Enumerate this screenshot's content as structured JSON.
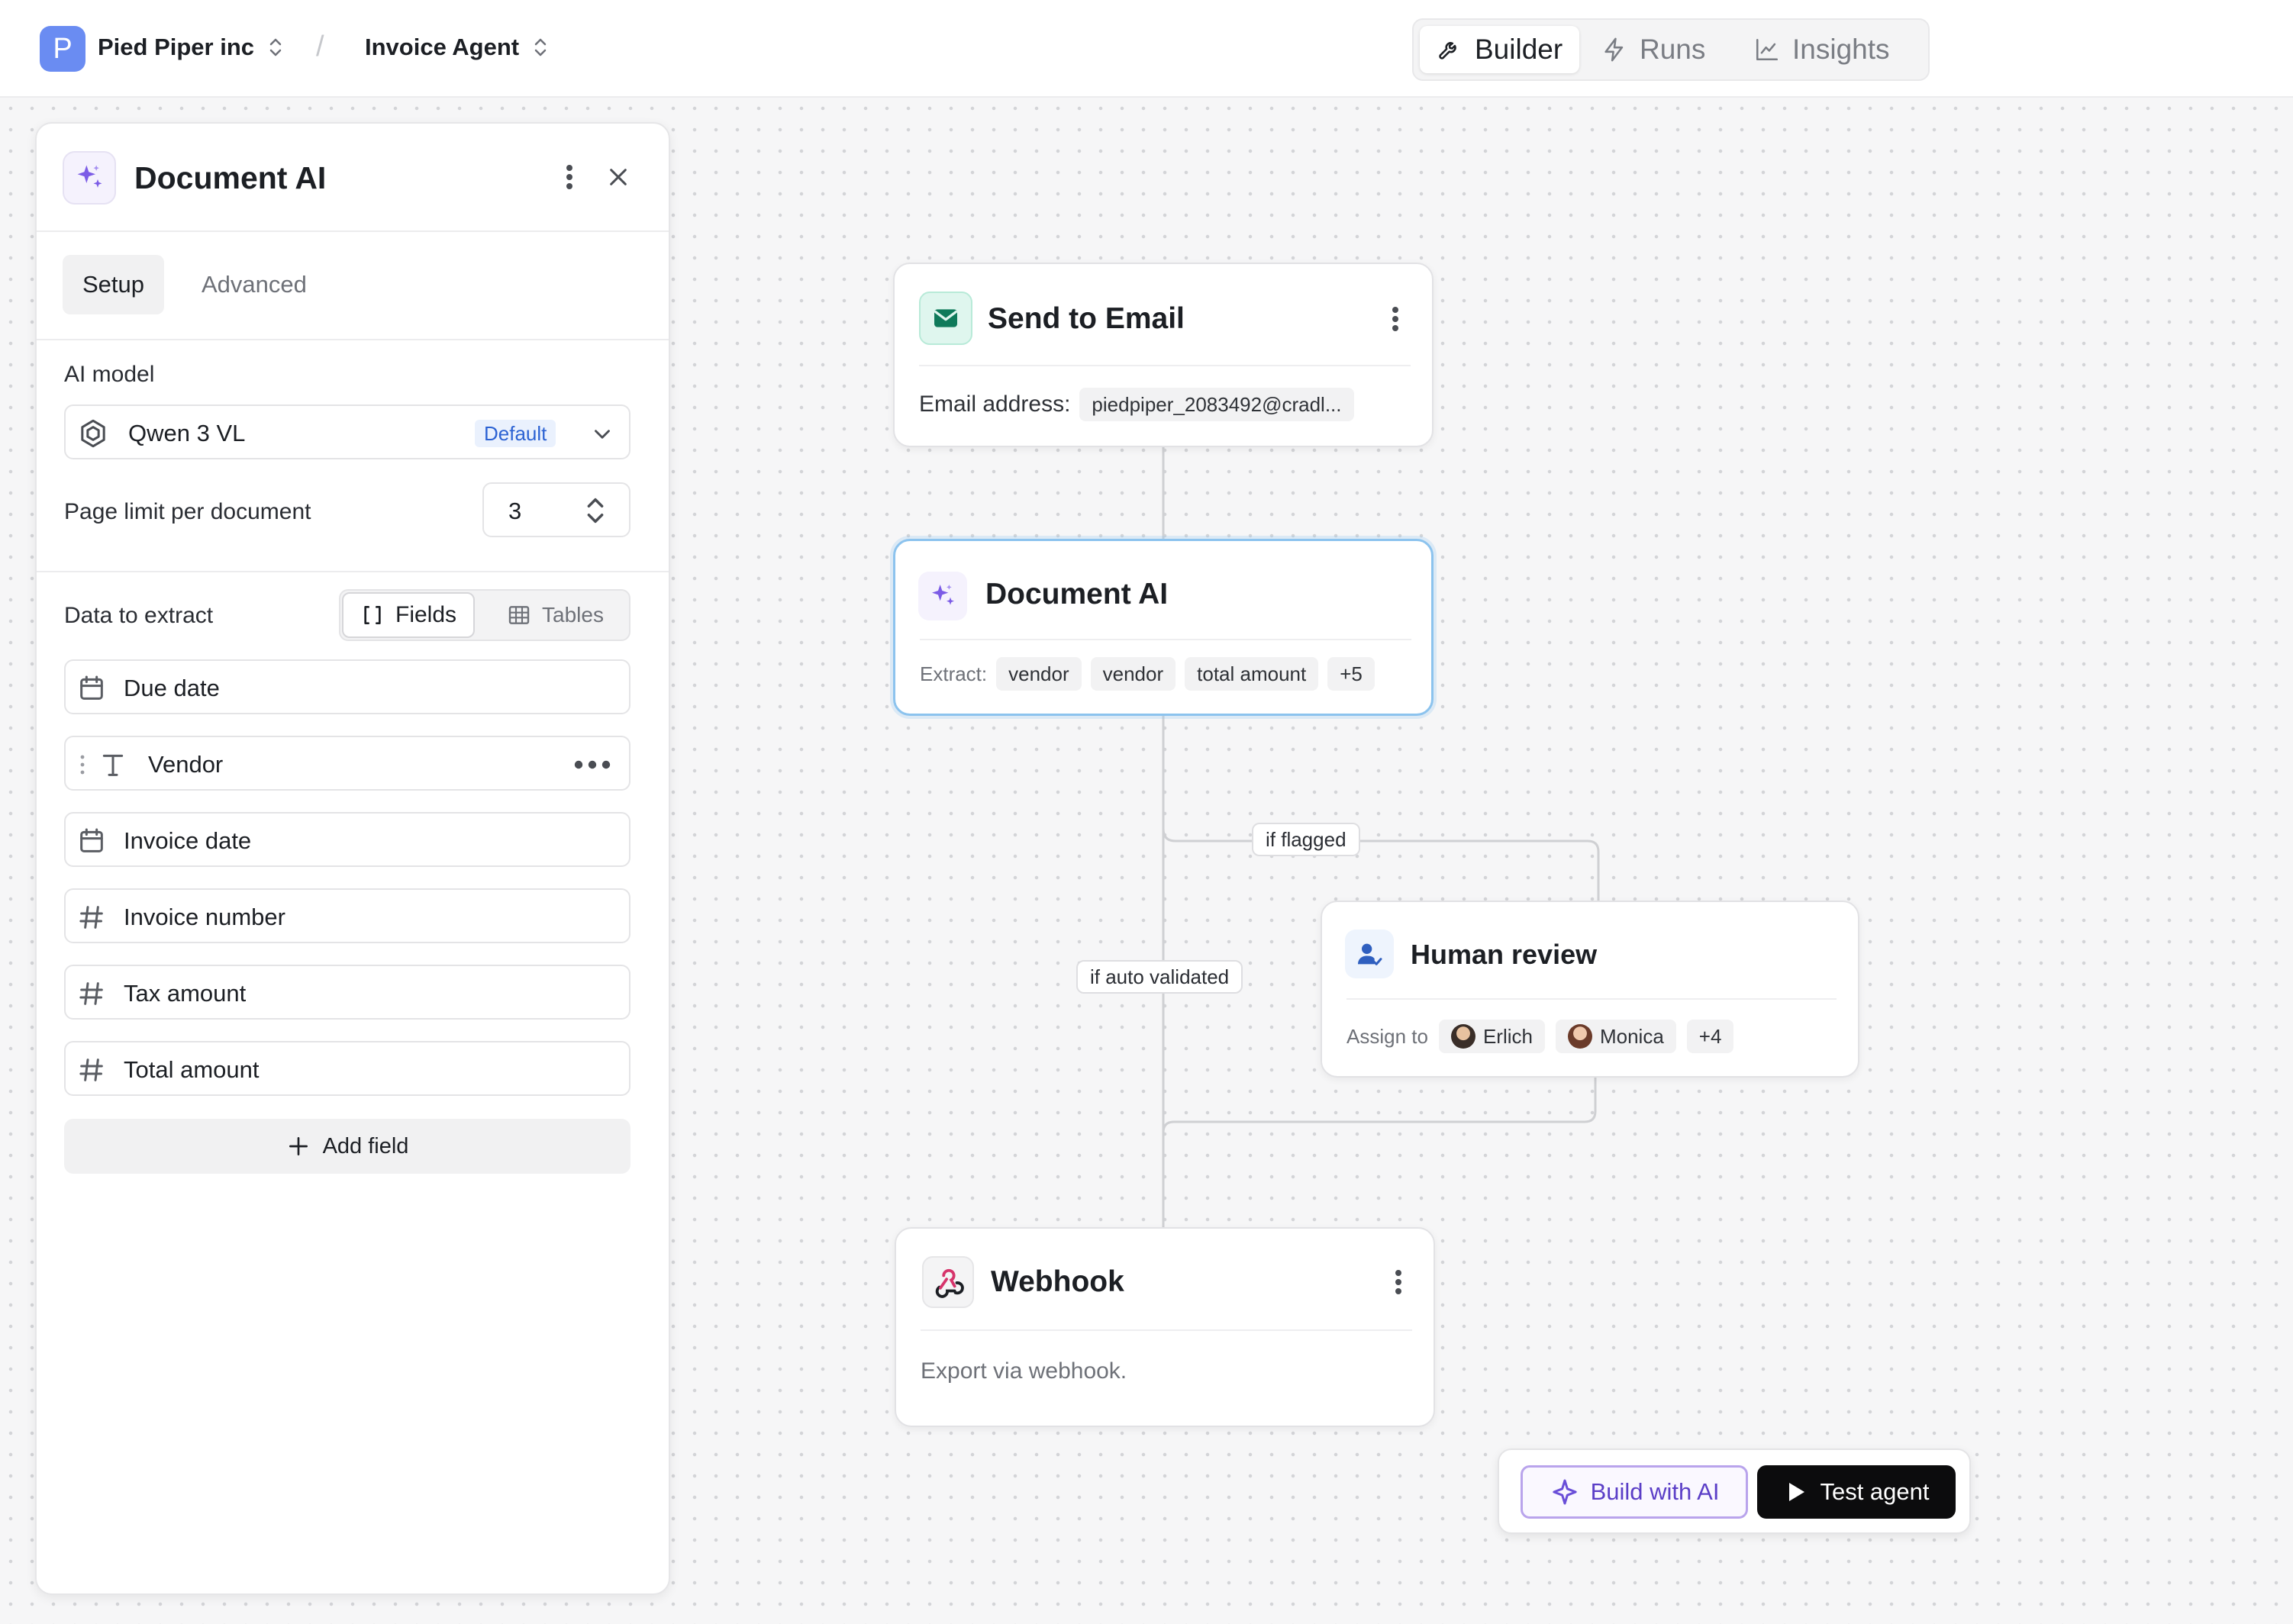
{
  "header": {
    "workspace_initial": "P",
    "workspace_name": "Pied Piper inc",
    "separator": "/",
    "agent_name": "Invoice Agent",
    "modes": [
      {
        "label": "Builder",
        "icon": "wrench-icon",
        "active": true
      },
      {
        "label": "Runs",
        "icon": "lightning-icon",
        "active": false
      },
      {
        "label": "Insights",
        "icon": "chart-line-icon",
        "active": false
      }
    ]
  },
  "panel": {
    "title": "Document AI",
    "icon": "sparkles-icon",
    "tabs": [
      {
        "label": "Setup",
        "active": true
      },
      {
        "label": "Advanced",
        "active": false
      }
    ],
    "ai_model": {
      "label": "AI model",
      "value": "Qwen 3 VL",
      "badge": "Default"
    },
    "page_limit": {
      "label": "Page limit per document",
      "value": "3"
    },
    "extract": {
      "label": "Data to extract",
      "segments": [
        "Fields",
        "Tables"
      ],
      "active_segment": "Fields",
      "fields": [
        {
          "name": "Due date",
          "icon": "calendar-icon"
        },
        {
          "name": "Vendor",
          "icon": "text-type-icon"
        },
        {
          "name": "Invoice date",
          "icon": "calendar-icon"
        },
        {
          "name": "Invoice number",
          "icon": "hash-icon"
        },
        {
          "name": "Tax amount",
          "icon": "hash-icon"
        },
        {
          "name": "Total amount",
          "icon": "hash-icon"
        }
      ],
      "add_label": "Add field"
    }
  },
  "nodes": {
    "email": {
      "title": "Send to Email",
      "icon": "mail-icon",
      "field_label": "Email address:",
      "field_value": "piedpiper_2083492@cradl..."
    },
    "docai": {
      "title": "Document AI",
      "icon": "sparkles-icon",
      "field_label": "Extract:",
      "chips": [
        "vendor",
        "vendor",
        "total amount",
        "+5"
      ]
    },
    "review": {
      "title": "Human review",
      "icon": "user-check-icon",
      "field_label": "Assign to",
      "assignees": [
        "Erlich",
        "Monica"
      ],
      "more": "+4"
    },
    "webhook": {
      "title": "Webhook",
      "icon": "webhook-icon",
      "description": "Export via webhook."
    }
  },
  "edges": {
    "flagged_label": "if flagged",
    "validated_label": "if auto validated"
  },
  "actions": {
    "build_label": "Build with AI",
    "test_label": "Test agent"
  },
  "colors": {
    "accent_purple": "#7c5ce6",
    "selected_border": "#8cc3ee",
    "default_badge": "#2d63d3",
    "email_icon": "#14b58d",
    "webhook_icon": "#d6346b"
  }
}
